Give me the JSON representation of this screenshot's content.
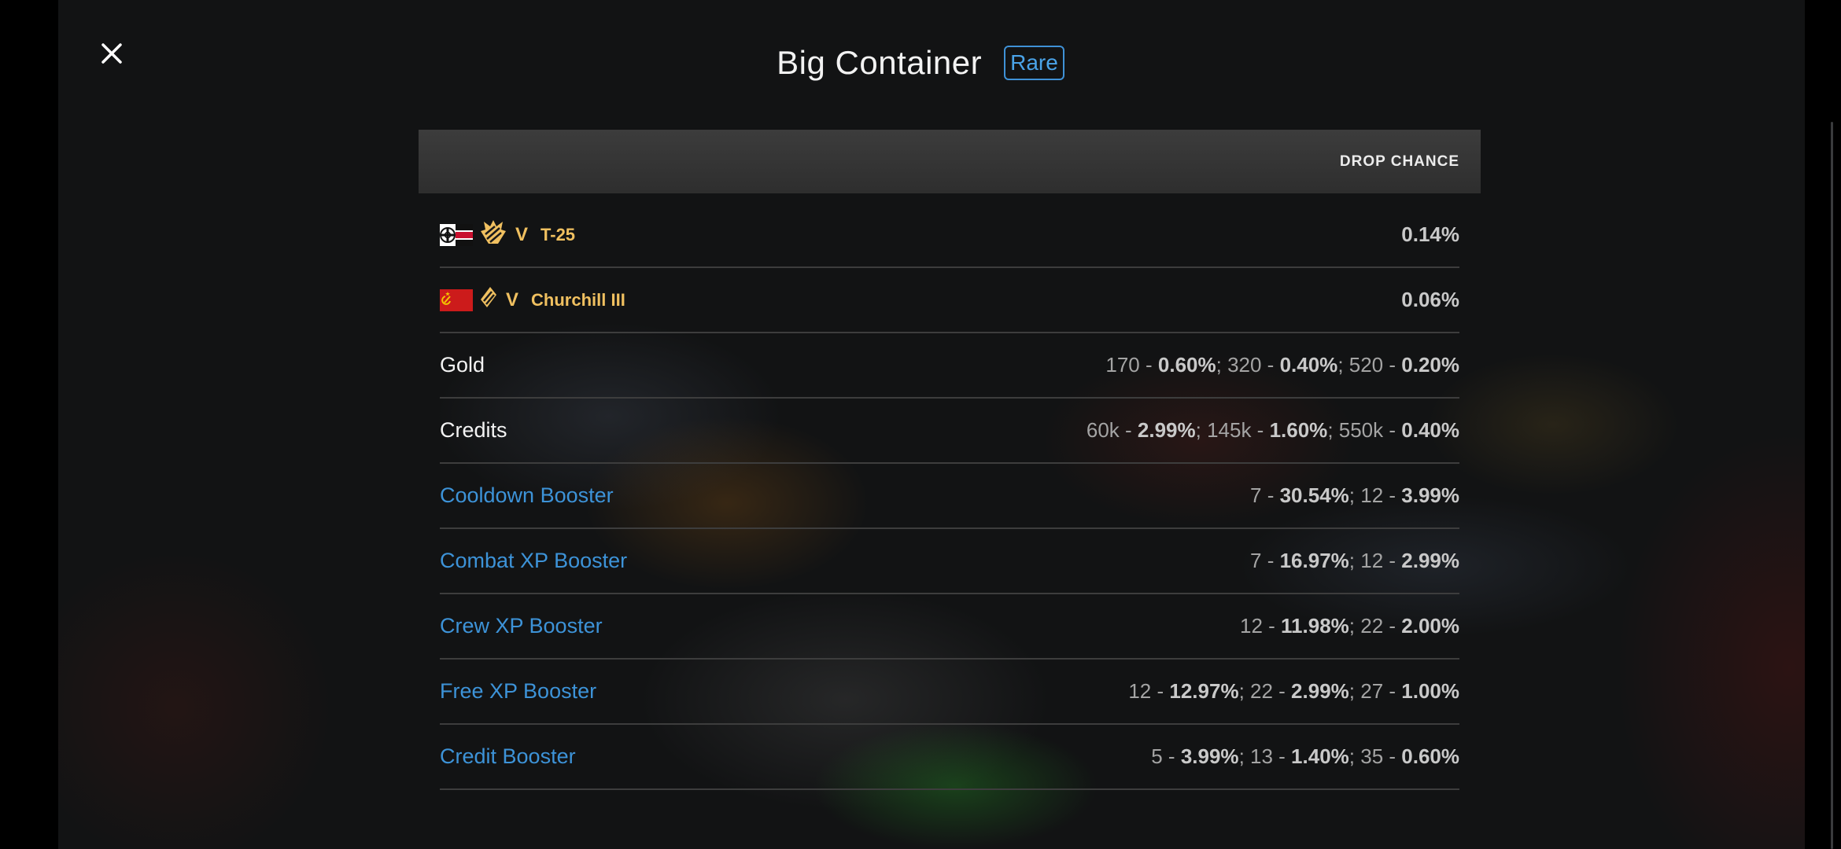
{
  "header": {
    "title": "Big Container",
    "rarity": "Rare"
  },
  "table": {
    "column_header": "DROP CHANCE",
    "rows": [
      {
        "type": "tank",
        "nation_icon": "germany-flag-icon",
        "class_icon": "tank-destroyer-class-icon",
        "tier": "V",
        "name": "T-25",
        "chance": "0.14%"
      },
      {
        "type": "tank",
        "nation_icon": "ussr-flag-icon",
        "class_icon": "heavy-tank-class-icon",
        "tier": "V",
        "name": "Churchill III",
        "chance": "0.06%"
      },
      {
        "type": "reward",
        "name": "Gold",
        "color": "#f3f3f3",
        "amounts": [
          {
            "amount": "170",
            "chance": "0.60%"
          },
          {
            "amount": "320",
            "chance": "0.40%"
          },
          {
            "amount": "520",
            "chance": "0.20%"
          }
        ]
      },
      {
        "type": "reward",
        "name": "Credits",
        "color": "#f3f3f3",
        "amounts": [
          {
            "amount": "60k",
            "chance": "2.99%"
          },
          {
            "amount": "145k",
            "chance": "1.60%"
          },
          {
            "amount": "550k",
            "chance": "0.40%"
          }
        ]
      },
      {
        "type": "reward",
        "name": "Cooldown Booster",
        "color": "#3d93d8",
        "amounts": [
          {
            "amount": "7",
            "chance": "30.54%"
          },
          {
            "amount": "12",
            "chance": "3.99%"
          }
        ]
      },
      {
        "type": "reward",
        "name": "Combat XP Booster",
        "color": "#3d93d8",
        "amounts": [
          {
            "amount": "7",
            "chance": "16.97%"
          },
          {
            "amount": "12",
            "chance": "2.99%"
          }
        ]
      },
      {
        "type": "reward",
        "name": "Crew XP Booster",
        "color": "#3d93d8",
        "amounts": [
          {
            "amount": "12",
            "chance": "11.98%"
          },
          {
            "amount": "22",
            "chance": "2.00%"
          }
        ]
      },
      {
        "type": "reward",
        "name": "Free XP Booster",
        "color": "#3d93d8",
        "amounts": [
          {
            "amount": "12",
            "chance": "12.97%"
          },
          {
            "amount": "22",
            "chance": "2.99%"
          },
          {
            "amount": "27",
            "chance": "1.00%"
          }
        ]
      },
      {
        "type": "reward",
        "name": "Credit Booster",
        "color": "#3d93d8",
        "amounts": [
          {
            "amount": "5",
            "chance": "3.99%"
          },
          {
            "amount": "13",
            "chance": "1.40%"
          },
          {
            "amount": "35",
            "chance": "0.60%"
          }
        ]
      }
    ]
  },
  "icons": {
    "close": "close-icon"
  },
  "colors": {
    "accent_blue": "#3d93d8",
    "tank_gold": "#f0c060",
    "background": "#121314"
  }
}
